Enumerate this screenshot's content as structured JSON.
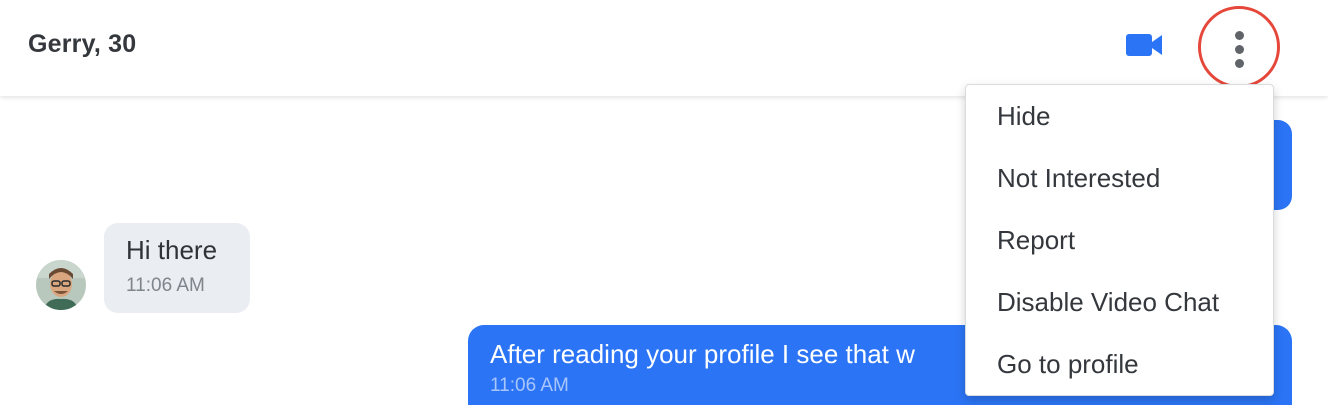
{
  "header": {
    "title": "Gerry, 30",
    "video_icon": "video-camera-icon",
    "more_icon": "vertical-ellipsis-icon"
  },
  "colors": {
    "accent": "#2b74f5",
    "highlight_ring": "#e5473a",
    "incoming_bubble": "#eaedf1"
  },
  "messages": [
    {
      "direction": "incoming",
      "text": "Hi there",
      "time": "11:06 AM"
    },
    {
      "direction": "outgoing",
      "text": "After reading your profile I see that w",
      "time": "11:06 AM"
    }
  ],
  "menu": {
    "items": [
      {
        "label": "Hide"
      },
      {
        "label": "Not Interested"
      },
      {
        "label": "Report"
      },
      {
        "label": "Disable Video Chat"
      },
      {
        "label": "Go to profile"
      }
    ]
  }
}
